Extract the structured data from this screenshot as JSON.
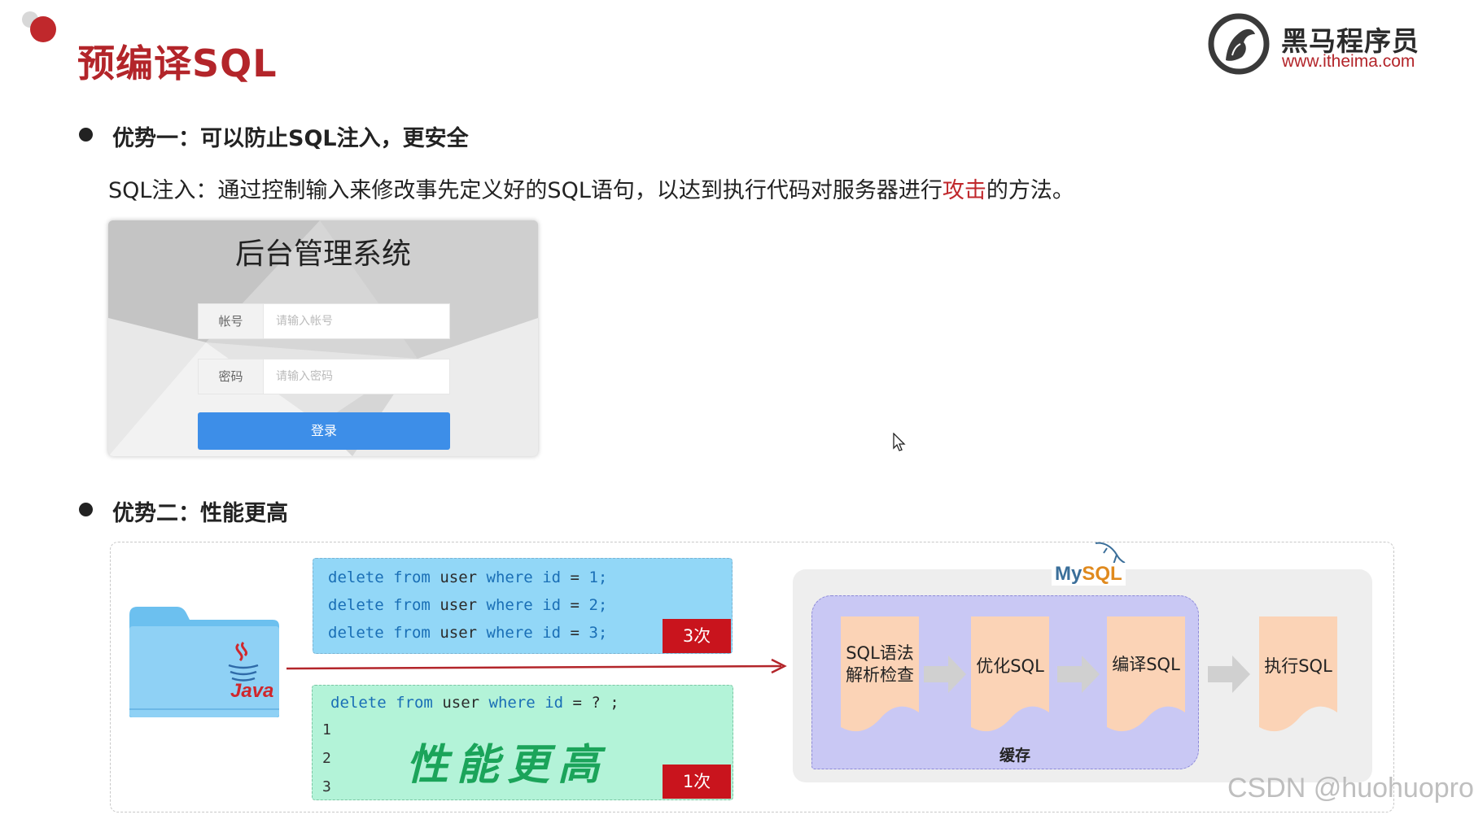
{
  "header": {
    "title": "预编译SQL",
    "logo_name": "黑马程序员",
    "logo_url": "www.itheima.com"
  },
  "advantage1": {
    "heading": "优势一：可以防止SQL注入，更安全",
    "desc_prefix": "SQL注入：通过控制输入来修改事先定义好的SQL语句，以达到执行代码对服务器进行",
    "desc_highlight": "攻击",
    "desc_suffix": "的方法。"
  },
  "login": {
    "title": "后台管理系统",
    "account_label": "帐号",
    "account_placeholder": "请输入帐号",
    "password_label": "密码",
    "password_placeholder": "请输入密码",
    "login_button": "登录"
  },
  "advantage2": {
    "heading": "优势二：性能更高"
  },
  "diagram": {
    "java_label": "Java",
    "statements": [
      {
        "kw1": "delete",
        "kw2": "from",
        "table": "user",
        "kw3": "where",
        "col": "id",
        "op": "=",
        "val": "1;"
      },
      {
        "kw1": "delete",
        "kw2": "from",
        "table": "user",
        "kw3": "where",
        "col": "id",
        "op": "=",
        "val": "2;"
      },
      {
        "kw1": "delete",
        "kw2": "from",
        "table": "user",
        "kw3": "where",
        "col": "id",
        "op": "=",
        "val": "3;"
      }
    ],
    "badge_top": "3次",
    "prepared": {
      "kw1": "delete",
      "kw2": "from",
      "table": "user",
      "kw3": "where",
      "col": "id",
      "rest": "= ? ;"
    },
    "line_numbers": [
      "1",
      "2",
      "3"
    ],
    "performance_text": "性能更高",
    "badge_bottom": "1次",
    "mysql_my": "My",
    "mysql_sql": "SQL",
    "steps": [
      "SQL语法",
      "解析检查",
      "优化SQL",
      "编译SQL",
      "执行SQL"
    ],
    "cache_label": "缓存"
  },
  "watermark": "CSDN @huohuopro",
  "colors": {
    "brand_red": "#b3252a",
    "code_blue_bg": "#92d7f7",
    "code_green_bg": "#b3f3d8",
    "badge_red": "#c9141d",
    "cache_purple": "#c9c8f4",
    "step_peach": "#fbd3b6"
  }
}
